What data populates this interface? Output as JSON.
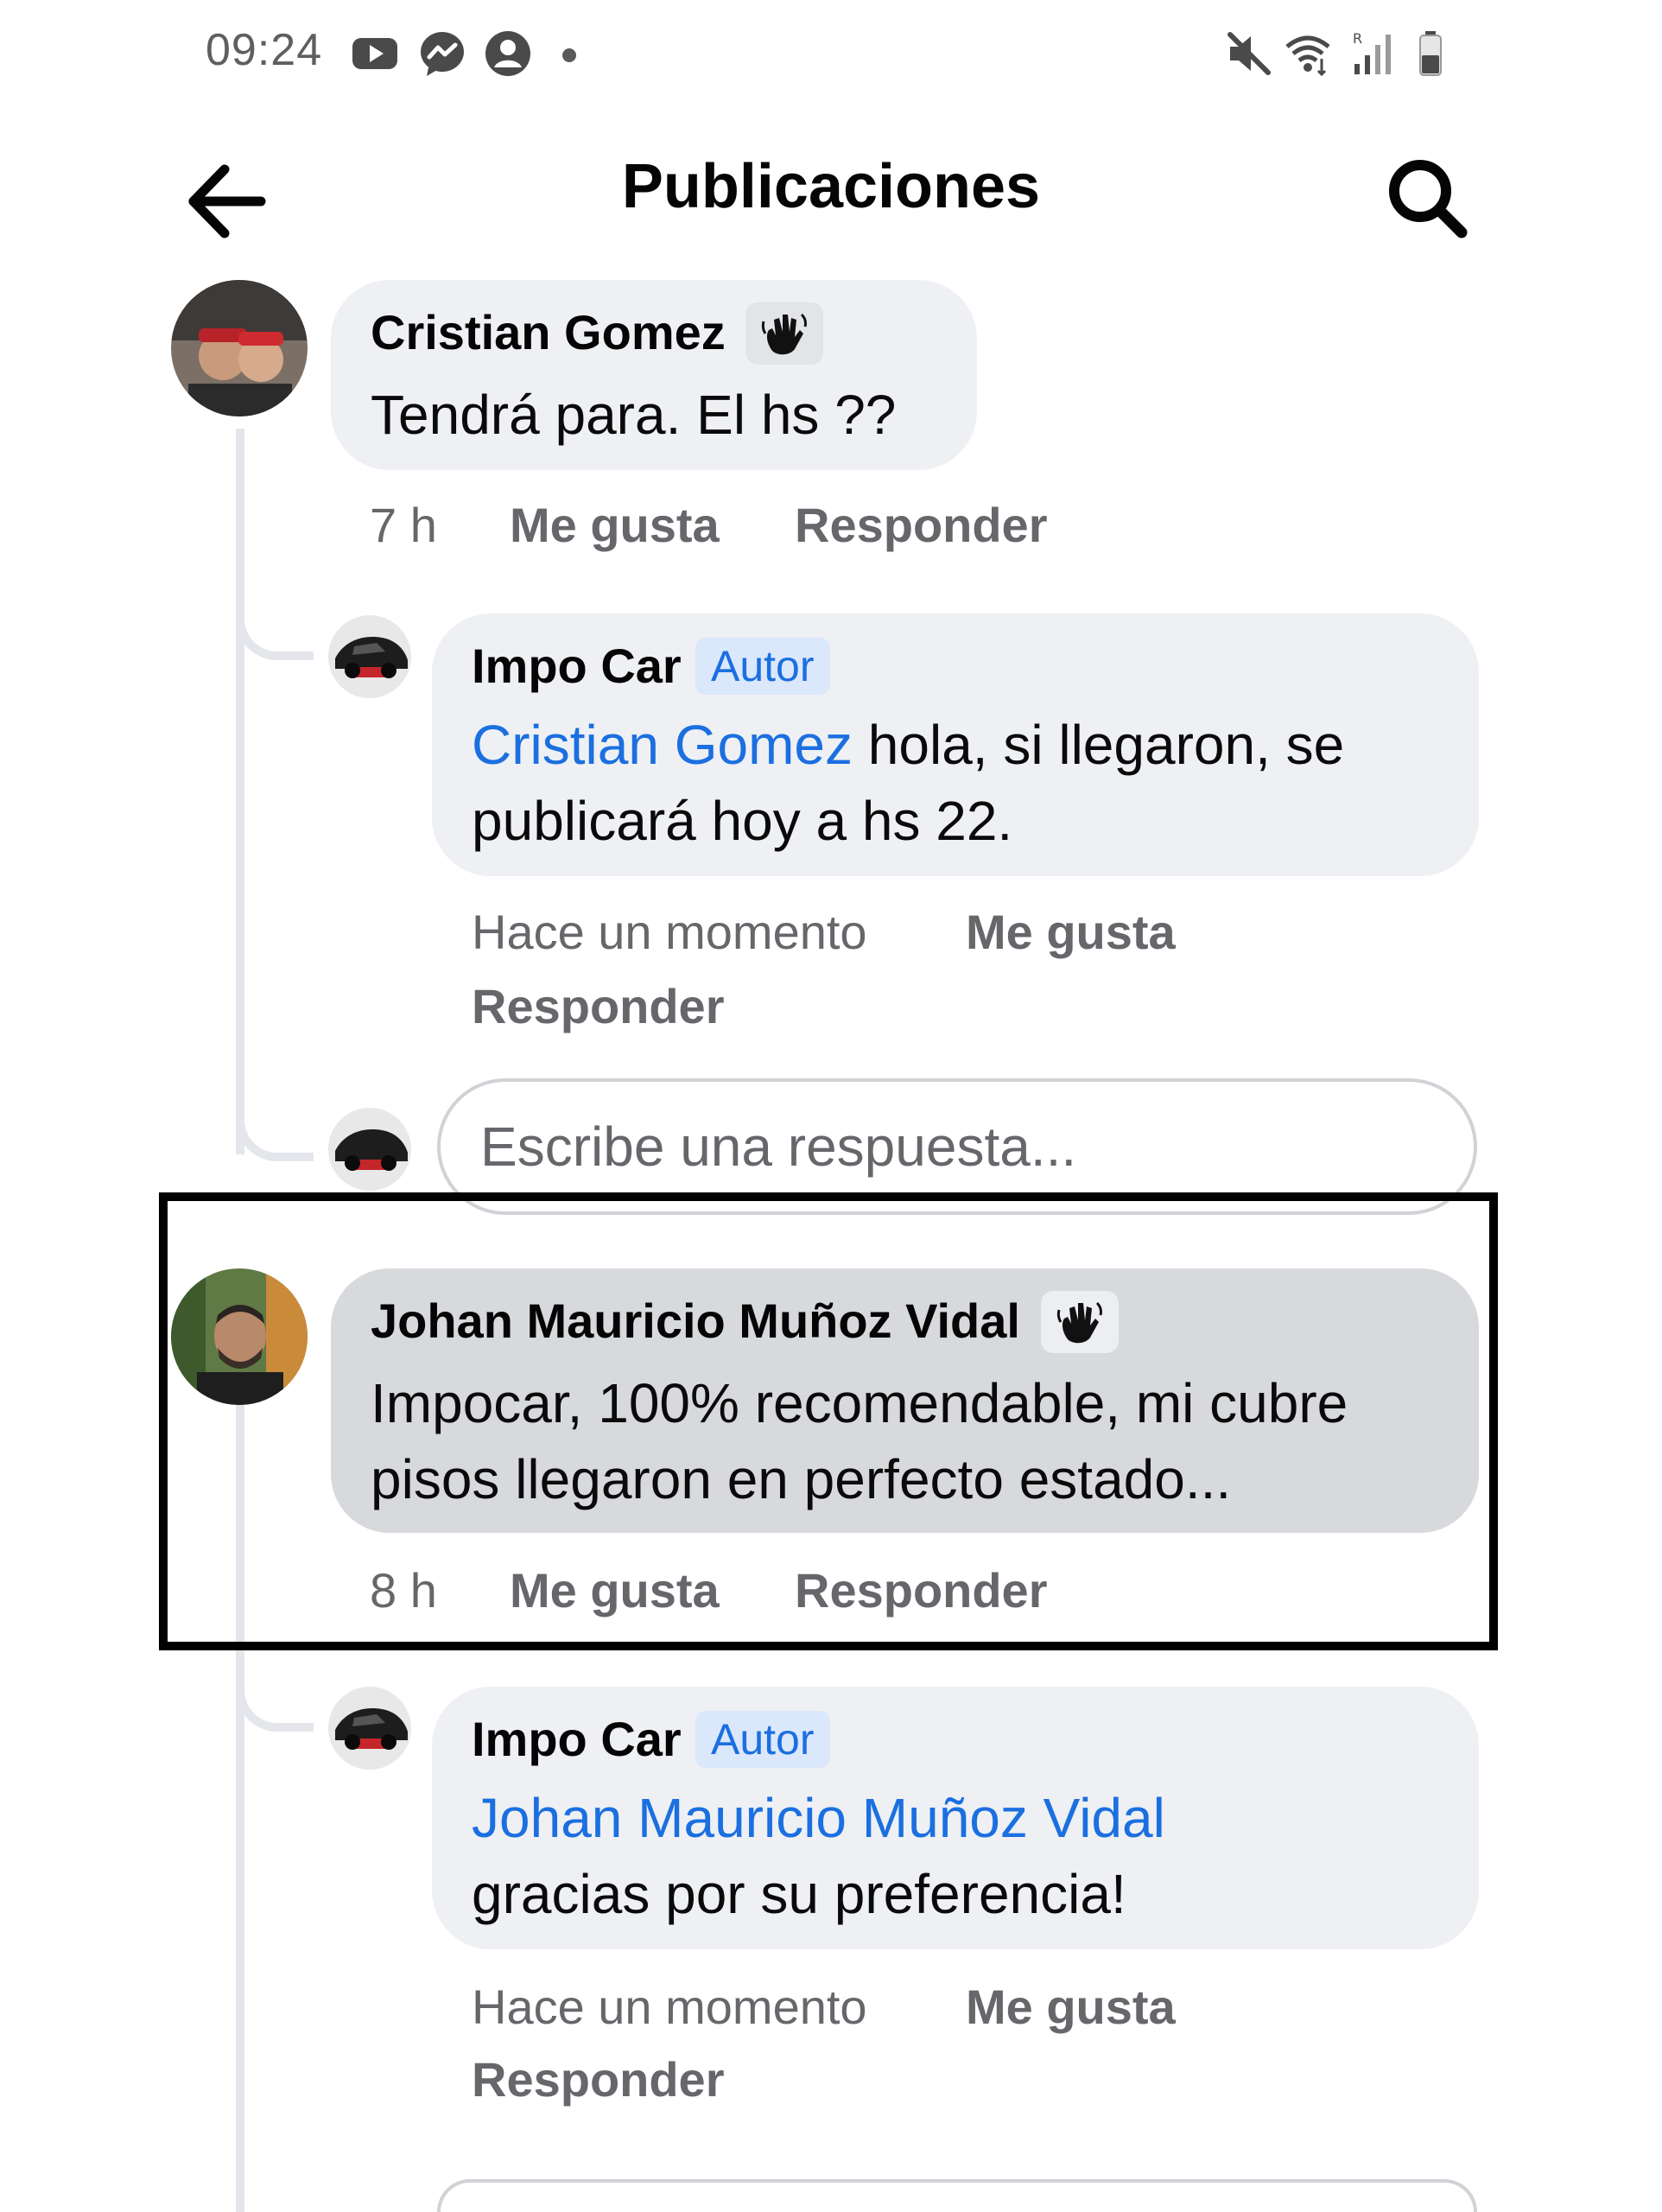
{
  "status_bar": {
    "time": "09:24",
    "icons": [
      "youtube-icon",
      "messenger-icon",
      "account-icon",
      "dot",
      "mute-icon",
      "wifi-icon",
      "signal-icon",
      "battery-icon"
    ]
  },
  "header": {
    "title": "Publicaciones",
    "back_icon": "arrow-left-icon",
    "search_icon": "search-icon"
  },
  "actions": {
    "like": "Me gusta",
    "reply": "Responder"
  },
  "comments": [
    {
      "author": "Cristian Gomez",
      "badge_icon": "waving-hand-icon",
      "text": "Tendrá para. El hs ??",
      "time": "7 h",
      "replies": [
        {
          "author": "Impo Car",
          "badge": "Autor",
          "mention": "Cristian Gomez",
          "text_line1": "hola, si llegaron, se",
          "text_line2": "publicará hoy a hs 22.",
          "time": "Hace un momento"
        }
      ]
    },
    {
      "author": "Johan Mauricio Muñoz Vidal",
      "badge_icon": "waving-hand-icon",
      "text_line1": "Impocar, 100% recomendable, mi cubre",
      "text_line2": "pisos llegaron en perfecto estado...",
      "time": "8 h",
      "highlighted": true,
      "replies": [
        {
          "author": "Impo Car",
          "badge": "Autor",
          "mention": "Johan Mauricio Muñoz Vidal",
          "text_line2": "gracias por su preferencia!",
          "time": "Hace un momento"
        }
      ]
    }
  ],
  "reply_input": {
    "placeholder": "Escribe una respuesta..."
  },
  "colors": {
    "mention": "#1b6fe0",
    "bubble": "#eef0f3",
    "bubble_highlighted": "#d7d9dc",
    "secondary_text": "#65676b",
    "highlight_border": "#000000"
  }
}
